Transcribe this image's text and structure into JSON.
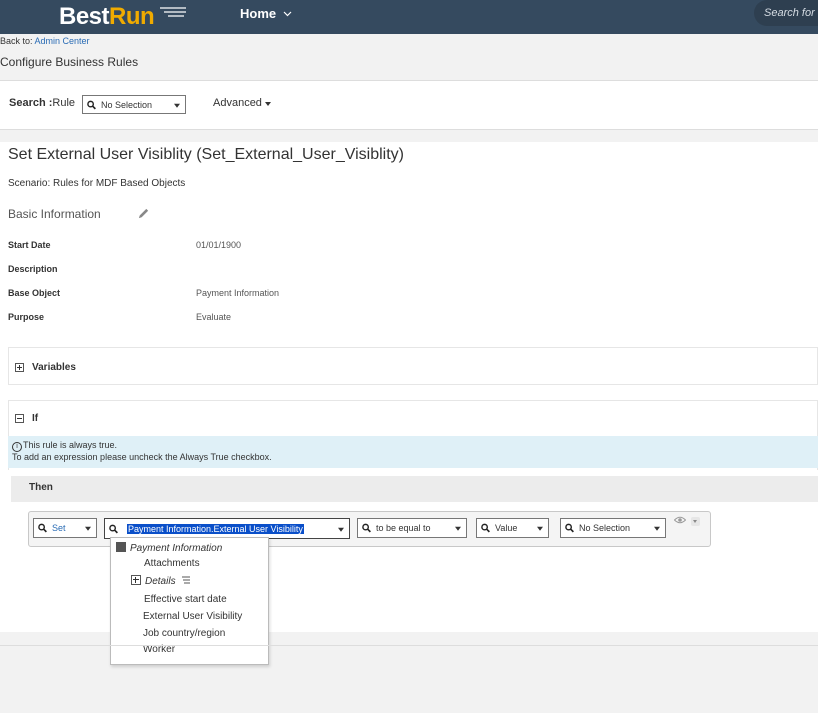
{
  "header": {
    "logo_part1": "Best",
    "logo_part2": "Run",
    "home_label": "Home",
    "search_placeholder": "Search for"
  },
  "breadcrumb": {
    "back_prefix": "Back to:",
    "back_link": "Admin Center"
  },
  "page_title": "Configure Business Rules",
  "searchbar": {
    "label": "Search :",
    "scope": "Rule",
    "selection": "No Selection",
    "advanced": "Advanced"
  },
  "rule": {
    "title": "Set External User Visiblity (Set_External_User_Visiblity)",
    "scenario": "Scenario: Rules for MDF Based Objects",
    "basic_info": "Basic Information",
    "fields": [
      {
        "label": "Start Date",
        "value": "01/01/1900"
      },
      {
        "label": "Description",
        "value": ""
      },
      {
        "label": "Base Object",
        "value": "Payment Information"
      },
      {
        "label": "Purpose",
        "value": "Evaluate"
      }
    ]
  },
  "variables_label": "Variables",
  "if_label": "If",
  "info": {
    "line1": "This rule is always true.",
    "line2": "To add an expression please uncheck the Always True checkbox."
  },
  "then": {
    "label": "Then",
    "action": "Set",
    "field": "Payment Information.External User Visibility",
    "operator": "to be equal to",
    "value_type": "Value",
    "value": "No Selection"
  },
  "dropdown": {
    "root": "Payment Information",
    "items": [
      "Attachments",
      "Details",
      "Effective start date",
      "External User Visibility",
      "Job country/region",
      "Worker"
    ],
    "highlight_color": "#f6f000"
  }
}
